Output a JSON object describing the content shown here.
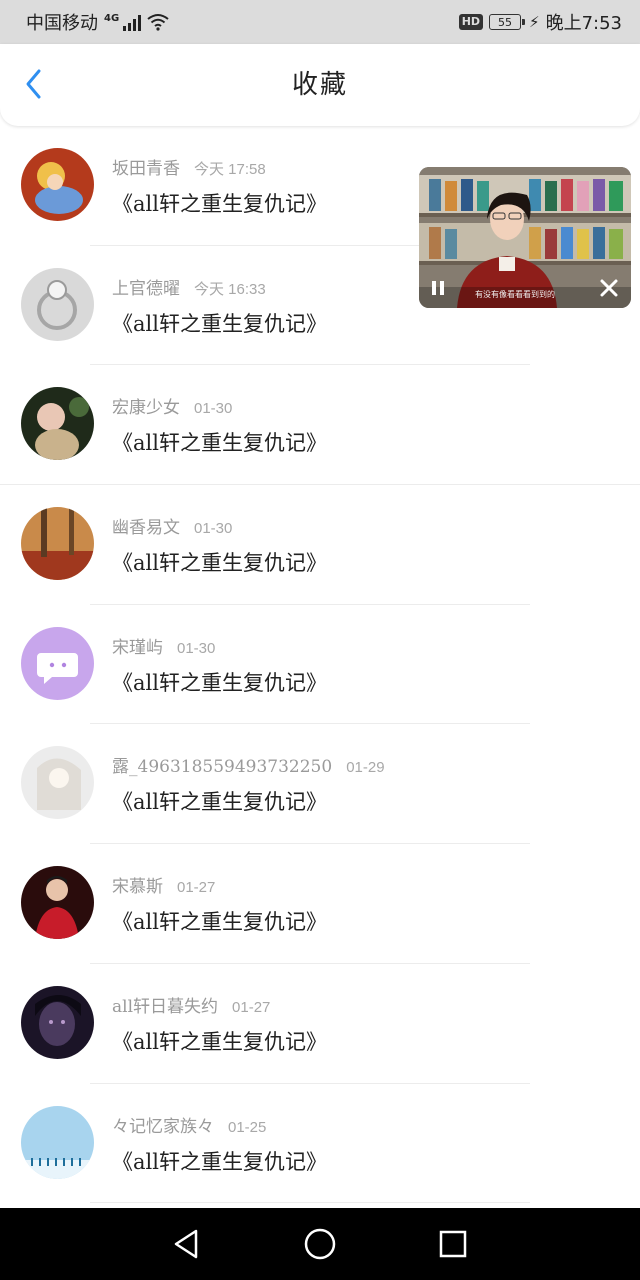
{
  "status_bar": {
    "carrier": "中国移动",
    "network_type": "4G",
    "hd_label": "HD",
    "battery_level": "55",
    "time": "晚上7:53"
  },
  "header": {
    "title": "收藏",
    "back_icon": "chevron-left-icon",
    "accent_color": "#2f8ff0"
  },
  "favorites": [
    {
      "user": "坂田青香",
      "time": "今天 17:58",
      "book": "《all轩之重生复仇记》"
    },
    {
      "user": "上官德曜",
      "time": "今天 16:33",
      "book": "《all轩之重生复仇记》"
    },
    {
      "user": "宏康少女",
      "time": "01-30",
      "book": "《all轩之重生复仇记》"
    },
    {
      "user": "幽香易文",
      "time": "01-30",
      "book": "《all轩之重生复仇记》"
    },
    {
      "user": "宋瑾屿",
      "time": "01-30",
      "book": "《all轩之重生复仇记》"
    },
    {
      "user": "露_496318559493732250",
      "time": "01-29",
      "book": "《all轩之重生复仇记》"
    },
    {
      "user": "宋慕斯",
      "time": "01-27",
      "book": "《all轩之重生复仇记》"
    },
    {
      "user": "all轩日暮失约",
      "time": "01-27",
      "book": "《all轩之重生复仇记》"
    },
    {
      "user": "々记忆家族々",
      "time": "01-25",
      "book": "《all轩之重生复仇记》"
    }
  ],
  "video": {
    "subtitle": "有没有像看看看到到的",
    "pause_icon": "pause-icon",
    "close_icon": "close-icon"
  },
  "nav_bar": {
    "back_icon": "triangle-back-icon",
    "home_icon": "circle-home-icon",
    "recents_icon": "square-recents-icon"
  }
}
